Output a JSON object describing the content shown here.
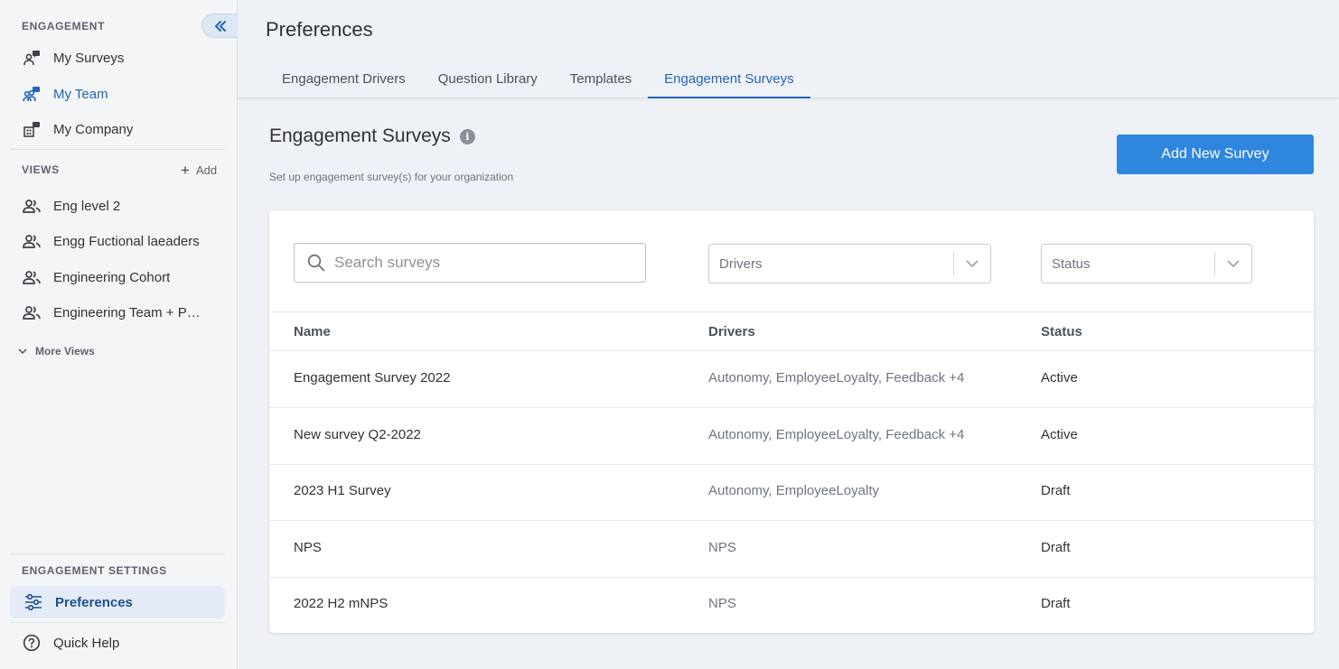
{
  "sidebar": {
    "engagement_title": "ENGAGEMENT",
    "engagement_items": [
      {
        "label": "My Surveys"
      },
      {
        "label": "My Team"
      },
      {
        "label": "My Company"
      }
    ],
    "views_title": "VIEWS",
    "add_label": "Add",
    "views_items": [
      {
        "label": "Eng level 2"
      },
      {
        "label": "Engg Fuctional laeaders"
      },
      {
        "label": "Engineering Cohort"
      },
      {
        "label": "Engineering Team + People Team"
      }
    ],
    "more_views_label": "More Views",
    "settings_title": "ENGAGEMENT SETTINGS",
    "preferences_label": "Preferences",
    "quick_help_label": "Quick Help"
  },
  "header": {
    "title": "Preferences",
    "tabs": [
      {
        "label": "Engagement Drivers"
      },
      {
        "label": "Question Library"
      },
      {
        "label": "Templates"
      },
      {
        "label": "Engagement Surveys"
      }
    ],
    "active_tab": "Engagement Surveys"
  },
  "main": {
    "title": "Engagement Surveys",
    "subtitle": "Set up engagement survey(s) for your organization",
    "add_button_label": "Add New Survey",
    "search_placeholder": "Search surveys",
    "drivers_select": "Drivers",
    "status_select": "Status",
    "columns": {
      "name": "Name",
      "drivers": "Drivers",
      "status": "Status"
    },
    "rows": [
      {
        "name": "Engagement Survey 2022",
        "drivers": "Autonomy, EmployeeLoyalty, Feedback +4",
        "status": "Active"
      },
      {
        "name": "New survey Q2-2022",
        "drivers": "Autonomy, EmployeeLoyalty, Feedback +4",
        "status": "Active"
      },
      {
        "name": "2023 H1 Survey",
        "drivers": "Autonomy, EmployeeLoyalty",
        "status": "Draft"
      },
      {
        "name": "NPS",
        "drivers": "NPS",
        "status": "Draft"
      },
      {
        "name": "2022 H2 mNPS",
        "drivers": "NPS",
        "status": "Draft"
      }
    ]
  },
  "colors": {
    "accent": "#2366b5",
    "primary_button": "#2f86df",
    "sidebar_bg": "#f4f5f7",
    "page_bg": "#eef1f5"
  }
}
